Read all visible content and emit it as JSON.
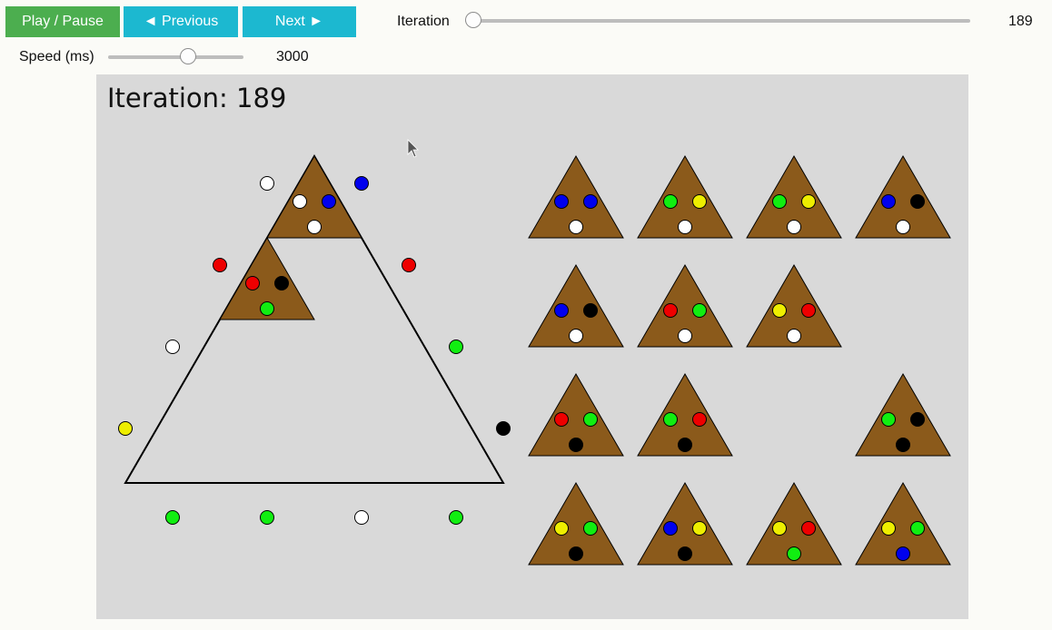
{
  "controls": {
    "play_pause_label": "Play / Pause",
    "previous_label": "◄ Previous",
    "next_label": "Next ►",
    "iteration_label": "Iteration",
    "iteration_value": "189",
    "iteration_level": 0.0,
    "speed_label": "Speed (ms)",
    "speed_value": "3000",
    "speed_level": 0.6
  },
  "canvas": {
    "title": "Iteration: 189"
  },
  "colors": {
    "tile_fill": "#8b5a1b",
    "panel_bg": "#d9d9d9",
    "play_button": "#4cae4f",
    "nav_button": "#1cb8d0"
  },
  "board": {
    "placed_tiles": [
      {
        "slot": "top",
        "pegs": [
          "white",
          "blue",
          "white"
        ]
      },
      {
        "slot": "second-row-left",
        "pegs": [
          "red",
          "black",
          "green"
        ]
      }
    ],
    "edge_pegs": [
      "white",
      "blue",
      "red",
      "red",
      "white",
      "green",
      "yellow",
      "black",
      "green",
      "green",
      "white",
      "green"
    ]
  },
  "spare_tiles": [
    [
      "blue",
      "blue",
      "white"
    ],
    [
      "green",
      "yellow",
      "white"
    ],
    [
      "green",
      "yellow",
      "white"
    ],
    [
      "blue",
      "black",
      "white"
    ],
    [
      "blue",
      "black",
      "white"
    ],
    [
      "red",
      "green",
      "white"
    ],
    [
      "yellow",
      "red",
      "white"
    ],
    null,
    [
      "red",
      "green",
      "black"
    ],
    [
      "green",
      "red",
      "black"
    ],
    null,
    [
      "green",
      "black",
      "black"
    ],
    [
      "yellow",
      "green",
      "black"
    ],
    [
      "blue",
      "yellow",
      "black"
    ],
    [
      "yellow",
      "red",
      "green"
    ],
    [
      "yellow",
      "green",
      "blue"
    ]
  ],
  "icons": {
    "cursor": "mouse-pointer-icon"
  }
}
